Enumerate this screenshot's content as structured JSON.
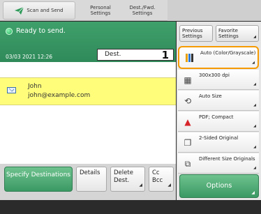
{
  "tabs": {
    "home_label": "Scan and Send",
    "personal_label": "Personal Settings",
    "shared_label": "Dest./Fwd. Settings"
  },
  "status": {
    "message": "Ready to send.",
    "datetime": "03/03 2021 12:26",
    "dest_label": "Dest.",
    "dest_count": "1"
  },
  "destinations": [
    {
      "name": "John",
      "email": "john@example.com"
    }
  ],
  "buttons": {
    "specify": "Specify Destinations",
    "details": "Details",
    "delete": "Delete Dest.",
    "cc": "Cc Bcc",
    "previous": "Previous Settings",
    "favorite": "Favorite Settings",
    "options": "Options"
  },
  "settings": [
    {
      "label": "Auto (Color/Grayscale)",
      "icon": "color-mode-icon"
    },
    {
      "label": "300x300 dpi",
      "icon": "resolution-icon"
    },
    {
      "label": "Auto Size",
      "icon": "scan-size-icon"
    },
    {
      "label": "PDF; Compact",
      "icon": "pdf-file-icon"
    },
    {
      "label": "2-Sided Original",
      "icon": "two-sided-icon"
    },
    {
      "label": "Different Size Originals",
      "icon": "different-size-icon"
    }
  ],
  "colors": {
    "accent_green": "#3b9963",
    "highlight_row": "#fffd7a",
    "selection_border": "#f59a00"
  }
}
